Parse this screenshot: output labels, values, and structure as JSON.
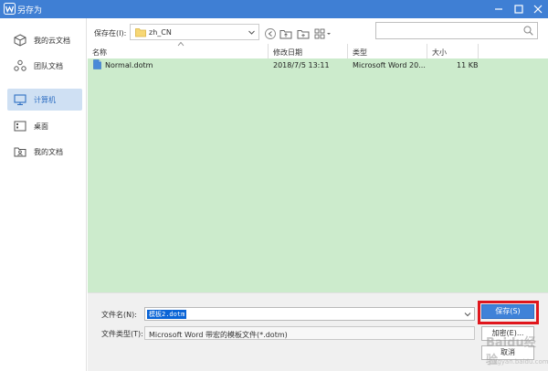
{
  "window": {
    "title": "另存为",
    "logo_icon": "wps-logo-icon",
    "accent_color": "#3f7fd4"
  },
  "sidebar": {
    "items": [
      {
        "label": "我的云文档",
        "icon": "cloud-cube-icon",
        "selected": false
      },
      {
        "label": "团队文档",
        "icon": "team-icon",
        "selected": false
      },
      {
        "label": "计算机",
        "icon": "monitor-icon",
        "selected": true
      },
      {
        "label": "桌面",
        "icon": "desktop-icon",
        "selected": false
      },
      {
        "label": "我的文档",
        "icon": "my-documents-icon",
        "selected": false
      }
    ]
  },
  "pathbar": {
    "label": "保存在(I):",
    "location": "zh_CN"
  },
  "search": {
    "placeholder": ""
  },
  "filelist": {
    "columns": [
      "名称",
      "修改日期",
      "类型",
      "大小"
    ],
    "rows": [
      {
        "name": "Normal.dotm",
        "modified": "2018/7/5 13:11",
        "type": "Microsoft Word 20...",
        "size": "11 KB"
      }
    ],
    "highlight_color": "#ccebcc"
  },
  "form": {
    "filename_label": "文件名(N):",
    "filename_value": "模板2.dotm",
    "filetype_label": "文件类型(T):",
    "filetype_value": "Microsoft Word 带宏的模板文件(*.dotm)"
  },
  "buttons": {
    "save": "保存(S)",
    "encrypt": "加密(E)...",
    "cancel": "取消"
  },
  "watermark": {
    "brand": "Baidu经验",
    "site": "jingyan.baidu.com"
  }
}
